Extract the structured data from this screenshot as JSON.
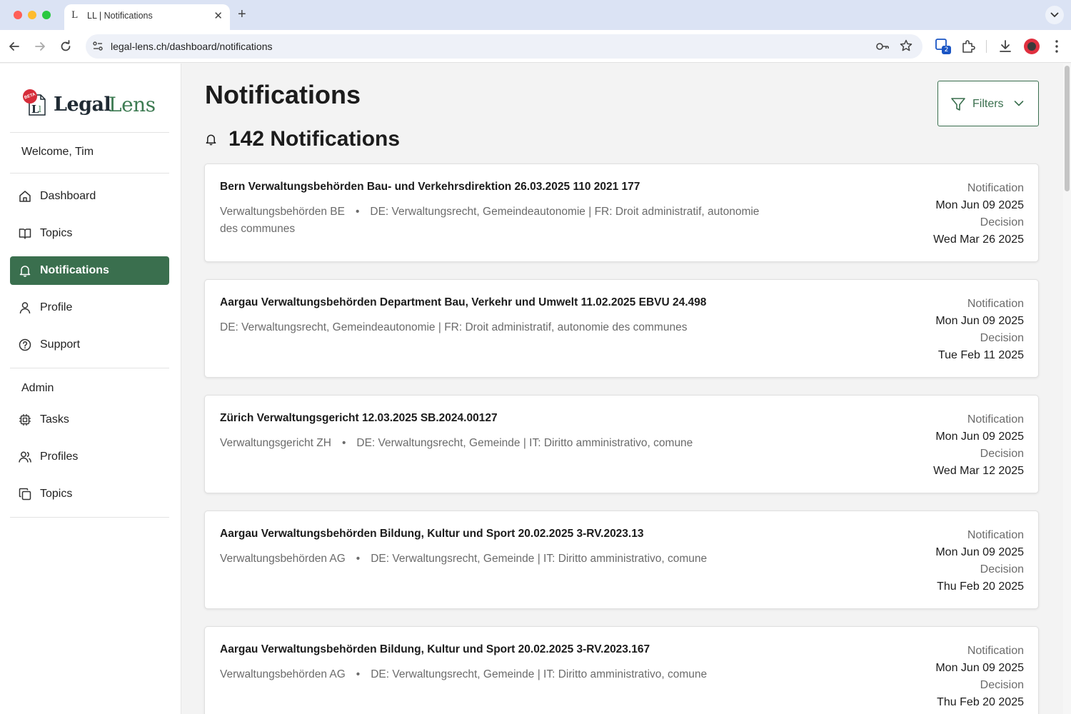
{
  "browser": {
    "tab_title": "LL | Notifications",
    "tab_favicon": "L",
    "tab_close": "✕",
    "new_tab": "+",
    "url": "legal-lens.ch/dashboard/notifications",
    "extension_badge": "2"
  },
  "sidebar": {
    "logo": {
      "beta": "BETA",
      "word1": "Legal",
      "word2": "Lens"
    },
    "welcome": "Welcome, Tim",
    "nav": [
      {
        "label": "Dashboard",
        "icon": "home-icon"
      },
      {
        "label": "Topics",
        "icon": "book-icon"
      },
      {
        "label": "Notifications",
        "icon": "bell-icon",
        "active": true
      },
      {
        "label": "Profile",
        "icon": "user-icon"
      },
      {
        "label": "Support",
        "icon": "help-circle-icon"
      }
    ],
    "admin_label": "Admin",
    "admin_nav": [
      {
        "label": "Tasks",
        "icon": "cpu-icon"
      },
      {
        "label": "Profiles",
        "icon": "users-icon"
      },
      {
        "label": "Topics",
        "icon": "copy-icon"
      }
    ]
  },
  "main": {
    "title": "Notifications",
    "count_label": "142 Notifications",
    "filters_label": "Filters",
    "notifications": [
      {
        "title": "Bern Verwaltungsbehörden Bau- und Verkehrsdirektion 26.03.2025 110 2021 177",
        "source": "Verwaltungsbehörden BE",
        "topics": "DE: Verwaltungsrecht, Gemeindeautonomie | FR: Droit administratif, autonomie des communes",
        "notification_label": "Notification",
        "notification_date": "Mon Jun 09 2025",
        "decision_label": "Decision",
        "decision_date": "Wed Mar 26 2025"
      },
      {
        "title": "Aargau Verwaltungsbehörden Department Bau, Verkehr und Umwelt 11.02.2025 EBVU 24.498",
        "source": "",
        "topics": "DE: Verwaltungsrecht, Gemeindeautonomie | FR: Droit administratif, autonomie des communes",
        "notification_label": "Notification",
        "notification_date": "Mon Jun 09 2025",
        "decision_label": "Decision",
        "decision_date": "Tue Feb 11 2025"
      },
      {
        "title": "Zürich Verwaltungsgericht 12.03.2025 SB.2024.00127",
        "source": "Verwaltungsgericht ZH",
        "topics": "DE: Verwaltungsrecht, Gemeinde | IT: Diritto amministrativo, comune",
        "notification_label": "Notification",
        "notification_date": "Mon Jun 09 2025",
        "decision_label": "Decision",
        "decision_date": "Wed Mar 12 2025"
      },
      {
        "title": "Aargau Verwaltungsbehörden Bildung, Kultur und Sport 20.02.2025 3-RV.2023.13",
        "source": "Verwaltungsbehörden AG",
        "topics": "DE: Verwaltungsrecht, Gemeinde | IT: Diritto amministrativo, comune",
        "notification_label": "Notification",
        "notification_date": "Mon Jun 09 2025",
        "decision_label": "Decision",
        "decision_date": "Thu Feb 20 2025"
      },
      {
        "title": "Aargau Verwaltungsbehörden Bildung, Kultur und Sport 20.02.2025 3-RV.2023.167",
        "source": "Verwaltungsbehörden AG",
        "topics": "DE: Verwaltungsrecht, Gemeinde | IT: Diritto amministrativo, comune",
        "notification_label": "Notification",
        "notification_date": "Mon Jun 09 2025",
        "decision_label": "Decision",
        "decision_date": "Thu Feb 20 2025"
      }
    ]
  },
  "colors": {
    "accent": "#3a6f4e",
    "logo_green": "#3d7b52",
    "beta_red": "#d62d3a",
    "page_bg": "#f3f3f3",
    "muted_text": "#6b6b6b"
  }
}
